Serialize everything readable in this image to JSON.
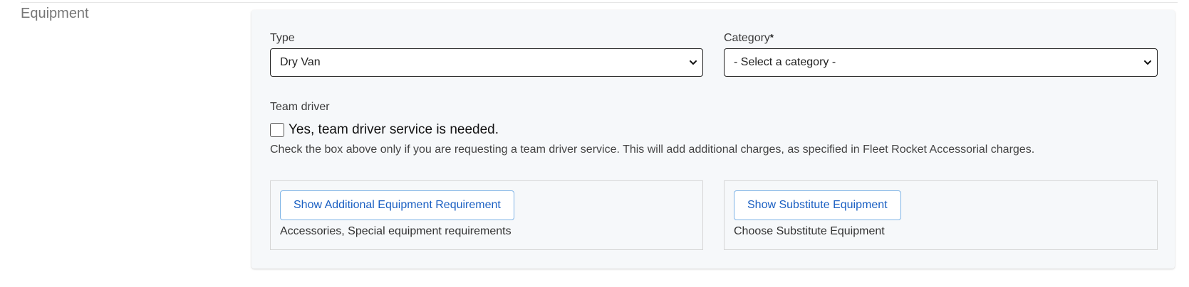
{
  "section": {
    "title": "Equipment"
  },
  "type_field": {
    "label": "Type",
    "selected": "Dry Van"
  },
  "category_field": {
    "label": "Category",
    "required_mark": "*",
    "selected": "- Select a category -"
  },
  "team_driver": {
    "label": "Team driver",
    "checkbox_label": "Yes, team driver service is needed.",
    "checked": false,
    "help_text": "Check the box above only if you are requesting a team driver service. This will add additional charges, as specified in Fleet Rocket Accessorial charges."
  },
  "additional_equipment": {
    "button_label": "Show Additional Equipment Requirement",
    "description": "Accessories, Special equipment requirements"
  },
  "substitute_equipment": {
    "button_label": "Show Substitute Equipment",
    "description": "Choose Substitute Equipment"
  },
  "colors": {
    "card_bg": "#f6f8fa",
    "button_text": "#1a5fc2",
    "button_border": "#7fb4e6",
    "heading": "#777777"
  },
  "icons": {
    "select_chevron": "chevron-down-icon"
  }
}
